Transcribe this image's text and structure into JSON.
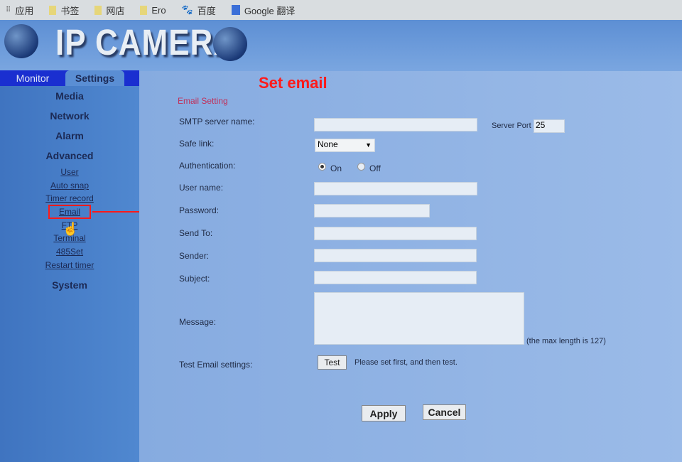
{
  "bookmarks": [
    {
      "label": "应用",
      "icon": "apps-icon"
    },
    {
      "label": "书签",
      "icon": "folder-icon"
    },
    {
      "label": "网店",
      "icon": "folder-icon"
    },
    {
      "label": "Ero",
      "icon": "folder-icon"
    },
    {
      "label": "百度",
      "icon": "baidu-icon"
    },
    {
      "label": "Google 翻译",
      "icon": "google-translate-icon"
    }
  ],
  "header": {
    "logo": "IP CAMERA"
  },
  "tabs": {
    "monitor": "Monitor",
    "settings": "Settings"
  },
  "sidebar": {
    "media": "Media",
    "network": "Network",
    "alarm": "Alarm",
    "advanced": "Advanced",
    "links": [
      "User",
      "Auto snap",
      "Timer record",
      "Email",
      "FTP",
      "Terminal",
      "485Set",
      "Restart timer"
    ],
    "system": "System"
  },
  "annotation": {
    "title": "Set email",
    "color": "#ff1a1a"
  },
  "form": {
    "section": "Email Setting",
    "smtp_label": "SMTP server name:",
    "smtp_value": "",
    "port_label": "Server Port",
    "port_value": "25",
    "safe_label": "Safe link:",
    "safe_value": "None",
    "auth_label": "Authentication:",
    "auth_on": "On",
    "auth_off": "Off",
    "auth_selected": "On",
    "user_label": "User name:",
    "pass_label": "Password:",
    "sendto_label": "Send To:",
    "sender_label": "Sender:",
    "subject_label": "Subject:",
    "message_label": "Message:",
    "max_note": "(the max length is 127)",
    "test_label": "Test Email settings:",
    "test_button": "Test",
    "test_note": "Please set first, and then test."
  },
  "buttons": {
    "apply": "Apply",
    "cancel": "Cancel"
  }
}
